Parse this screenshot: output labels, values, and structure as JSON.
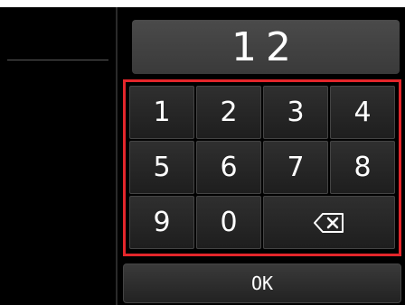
{
  "display": {
    "value": "12"
  },
  "keys": [
    "1",
    "2",
    "3",
    "4",
    "5",
    "6",
    "7",
    "8",
    "9",
    "0"
  ],
  "backspace_icon": "backspace-icon",
  "ok_label": "OK",
  "colors": {
    "highlight": "#e4262b"
  }
}
